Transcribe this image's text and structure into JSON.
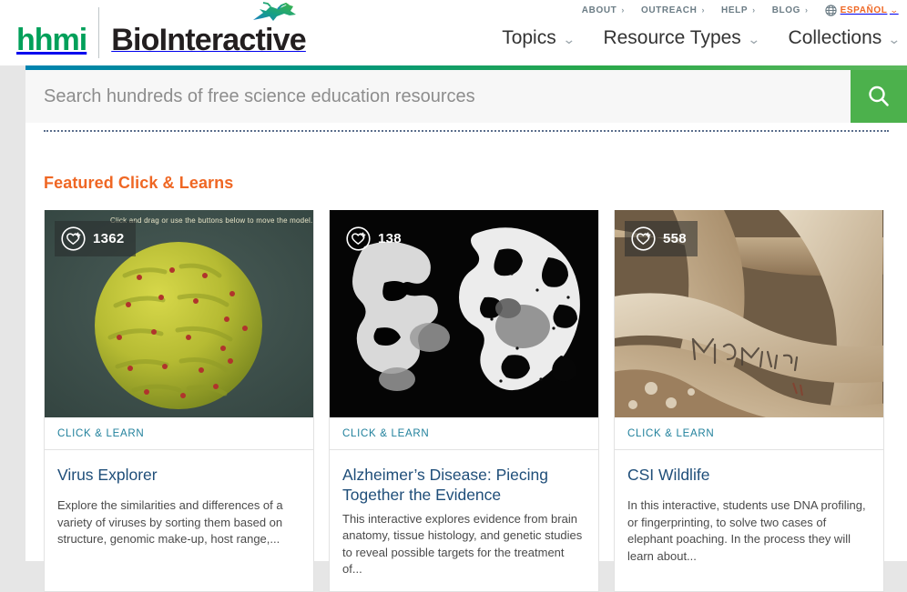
{
  "header": {
    "logo": {
      "hhmi": "hhmi",
      "biointeractive": "BioInteractive",
      "gecko_icon": "gecko-icon"
    },
    "utility_nav": [
      {
        "label": "ABOUT",
        "chevron": "›"
      },
      {
        "label": "OUTREACH",
        "chevron": "›"
      },
      {
        "label": "HELP",
        "chevron": "›"
      },
      {
        "label": "BLOG",
        "chevron": "›"
      }
    ],
    "language": {
      "icon": "globe-icon",
      "label": "ESPAÑOL",
      "caret": "⌄"
    },
    "main_nav": [
      {
        "label": "Topics",
        "caret": "⌄"
      },
      {
        "label": "Resource Types",
        "caret": "⌄"
      },
      {
        "label": "Collections",
        "caret": "⌄"
      }
    ],
    "accent_colors": {
      "hhmi_green": "#00a05a",
      "orange": "#ef6724",
      "gradient_start": "#0083b0",
      "gradient_end": "#5cb85c"
    }
  },
  "search": {
    "placeholder": "Search hundreds of free science education resources",
    "value": "",
    "button_icon": "search-icon",
    "button_color": "#4cb14c"
  },
  "main": {
    "section_title": "Featured Click & Learns",
    "cards": [
      {
        "kicker": "CLICK & LEARN",
        "title": "Virus Explorer",
        "description": "Explore the similarities and differences of a variety of viruses by sorting them based on structure, genomic make-up, host range,...",
        "likes": "1362",
        "like_icon": "heart-plus-icon",
        "image_overlay_text": "Click and drag or use the buttons below to move the model.",
        "image_alt": "virus-capsid-model"
      },
      {
        "kicker": "CLICK & LEARN",
        "title": "Alzheimer’s Disease: Piecing Together the Evidence",
        "description": "This interactive explores evidence from brain anatomy, tissue histology, and genetic studies to reveal possible targets for the treatment of...",
        "likes": "138",
        "like_icon": "heart-plus-icon",
        "image_overlay_text": "",
        "image_alt": "brain-cross-sections"
      },
      {
        "kicker": "CLICK & LEARN",
        "title": "CSI Wildlife",
        "description": "In this interactive, students use DNA profiling, or fingerprinting, to solve two cases of elephant poaching. In the process they will learn about...",
        "likes": "558",
        "like_icon": "heart-plus-icon",
        "image_overlay_text": "",
        "image_alt": "elephant-tusks"
      }
    ]
  }
}
